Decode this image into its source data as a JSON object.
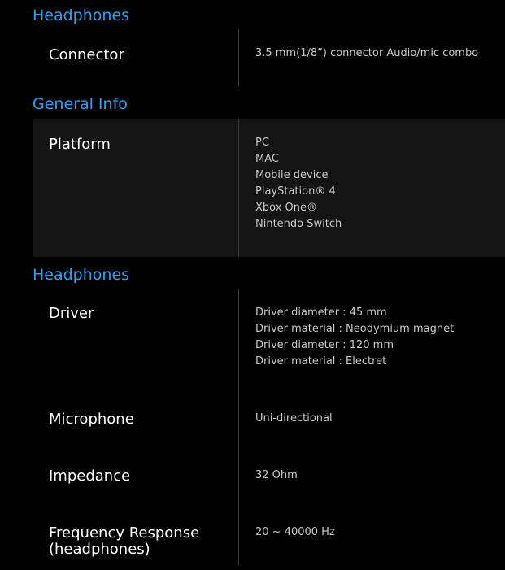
{
  "sections": [
    {
      "title": "Headphones",
      "rows": [
        {
          "label": "Connector",
          "values": [
            "3.5 mm(1/8”) connector Audio/mic combo"
          ]
        }
      ]
    },
    {
      "title": "General Info",
      "rows": [
        {
          "label": "Platform",
          "values": [
            "PC",
            "MAC",
            "Mobile device",
            "PlayStation® 4",
            "Xbox One®",
            "Nintendo Switch"
          ]
        }
      ]
    },
    {
      "title": "Headphones",
      "rows": [
        {
          "label": "Driver",
          "values": [
            "Driver diameter : 45 mm",
            "Driver material : Neodymium magnet",
            "Driver diameter : 120 mm",
            "Driver material : Electret"
          ]
        },
        {
          "label": "Microphone",
          "values": [
            "Uni-directional"
          ]
        },
        {
          "label": "Impedance",
          "values": [
            "32 Ohm"
          ]
        },
        {
          "label": "Frequency Response (headphones)",
          "values": [
            "20 ~ 40000 Hz"
          ]
        }
      ]
    }
  ],
  "colors": {
    "background": "#000000",
    "section_title": "#2fa0f0",
    "row_shade": "#141414",
    "label": "#ffffff",
    "value": "#c8c8c8",
    "divider": "#3a3a3a"
  }
}
